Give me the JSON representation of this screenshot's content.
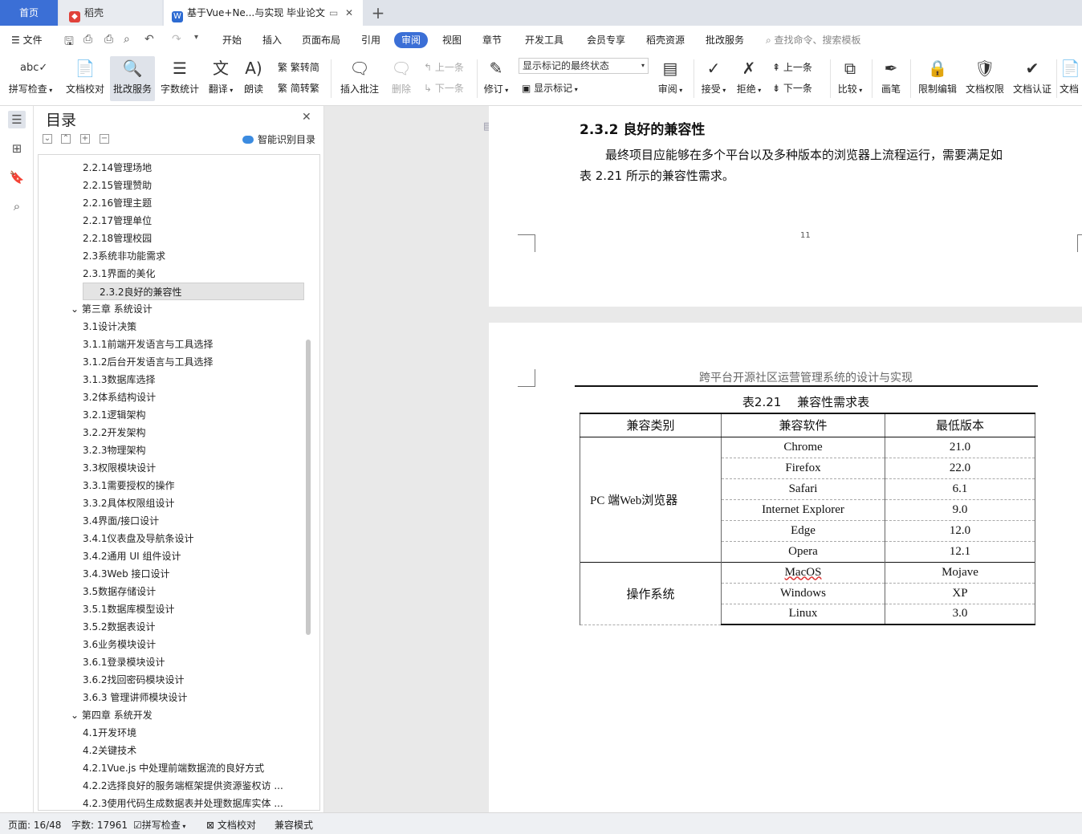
{
  "tabs": {
    "home": "首页",
    "daoke": "稻壳",
    "doc": "基于Vue+Ne...与实现 毕业论文"
  },
  "menu": {
    "file": "文件",
    "items": [
      "开始",
      "插入",
      "页面布局",
      "引用",
      "审阅",
      "视图",
      "章节",
      "开发工具",
      "会员专享",
      "稻壳资源",
      "批改服务"
    ],
    "active": "审阅",
    "search_placeholder": "查找命令、搜索模板"
  },
  "ribbon": {
    "spell": "拼写检查",
    "proof": "文档校对",
    "correct": "批改服务",
    "wordcount": "字数统计",
    "translate": "翻译",
    "read": "朗读",
    "trad_to_simp": "繁转简",
    "simp_to_trad": "简转繁",
    "insert_comment": "插入批注",
    "delete": "删除",
    "prev": "上一条",
    "next": "下一条",
    "revise": "修订",
    "markup_state": "显示标记的最终状态",
    "show_markup": "显示标记",
    "review": "审阅",
    "accept": "接受",
    "reject": "拒绝",
    "prev2": "上一条",
    "next2": "下一条",
    "compare": "比较",
    "pen": "画笔",
    "restrict": "限制编辑",
    "permission": "文档权限",
    "certify": "文档认证",
    "more": "文档"
  },
  "toc": {
    "title": "目录",
    "smart": "智能识别目录",
    "selected_index": 7,
    "items": [
      {
        "label": "2.2.14管理场地",
        "level": 3
      },
      {
        "label": "2.2.15管理赞助",
        "level": 3
      },
      {
        "label": "2.2.16管理主题",
        "level": 3
      },
      {
        "label": "2.2.17管理单位",
        "level": 3
      },
      {
        "label": "2.2.18管理校园",
        "level": 3
      },
      {
        "label": "2.3系统非功能需求",
        "level": 3
      },
      {
        "label": "2.3.1界面的美化",
        "level": 3
      },
      {
        "label": "2.3.2良好的兼容性",
        "level": 3
      },
      {
        "label": "第三章 系统设计",
        "level": 1
      },
      {
        "label": "3.1设计决策",
        "level": 3
      },
      {
        "label": "3.1.1前端开发语言与工具选择",
        "level": 3
      },
      {
        "label": "3.1.2后台开发语言与工具选择",
        "level": 3
      },
      {
        "label": "3.1.3数据库选择",
        "level": 3
      },
      {
        "label": "3.2体系结构设计",
        "level": 3
      },
      {
        "label": "3.2.1逻辑架构",
        "level": 3
      },
      {
        "label": "3.2.2开发架构",
        "level": 3
      },
      {
        "label": "3.2.3物理架构",
        "level": 3
      },
      {
        "label": "3.3权限模块设计",
        "level": 3
      },
      {
        "label": "3.3.1需要授权的操作",
        "level": 3
      },
      {
        "label": "3.3.2具体权限组设计",
        "level": 3
      },
      {
        "label": "3.4界面/接口设计",
        "level": 3
      },
      {
        "label": "3.4.1仪表盘及导航条设计",
        "level": 3
      },
      {
        "label": "3.4.2通用 UI 组件设计",
        "level": 3
      },
      {
        "label": "3.4.3Web 接口设计",
        "level": 3
      },
      {
        "label": "3.5数据存储设计",
        "level": 3
      },
      {
        "label": "3.5.1数据库模型设计",
        "level": 3
      },
      {
        "label": "3.5.2数据表设计",
        "level": 3
      },
      {
        "label": "3.6业务模块设计",
        "level": 3
      },
      {
        "label": "3.6.1登录模块设计",
        "level": 3
      },
      {
        "label": "3.6.2找回密码模块设计",
        "level": 3
      },
      {
        "label": "3.6.3 管理讲师模块设计",
        "level": 3
      },
      {
        "label": "第四章 系统开发",
        "level": 1
      },
      {
        "label": "4.1开发环境",
        "level": 3
      },
      {
        "label": "4.2关键技术",
        "level": 3
      },
      {
        "label": "4.2.1Vue.js 中处理前端数据流的良好方式",
        "level": 3
      },
      {
        "label": "4.2.2选择良好的服务端框架提供资源鉴权访 ...",
        "level": 3
      },
      {
        "label": "4.2.3使用代码生成数据表并处理数据库实体 ...",
        "level": 3
      }
    ]
  },
  "document": {
    "heading": "2.3.2 良好的兼容性",
    "para_line1": "最终项目应能够在多个平台以及多种版本的浏览器上流程运行，需要满足如",
    "para_line2": "表 2.21 所示的兼容性需求。",
    "page_number": "11",
    "running_header": "跨平台开源社区运营管理系统的设计与实现",
    "table_caption": "表2.21　 兼容性需求表",
    "table": {
      "headers": [
        "兼容类别",
        "兼容软件",
        "最低版本"
      ],
      "groups": [
        {
          "category": "PC 端Web浏览器",
          "rows": [
            [
              "Chrome",
              "21.0"
            ],
            [
              "Firefox",
              "22.0"
            ],
            [
              "Safari",
              "6.1"
            ],
            [
              "Internet Explorer",
              "9.0"
            ],
            [
              "Edge",
              "12.0"
            ],
            [
              "Opera",
              "12.1"
            ]
          ]
        },
        {
          "category": "操作系统",
          "rows": [
            [
              "MacOS",
              "Mojave"
            ],
            [
              "Windows",
              "XP"
            ],
            [
              "Linux",
              "3.0"
            ]
          ]
        }
      ]
    }
  },
  "status": {
    "page": "页面: 16/48",
    "words": "字数: 17961",
    "spell": "拼写检查",
    "proof": "文档校对",
    "mode": "兼容模式"
  },
  "colors": {
    "accent": "#3b6fd6",
    "daoke_red": "#e0413a",
    "wps_blue": "#2d6bd2"
  }
}
